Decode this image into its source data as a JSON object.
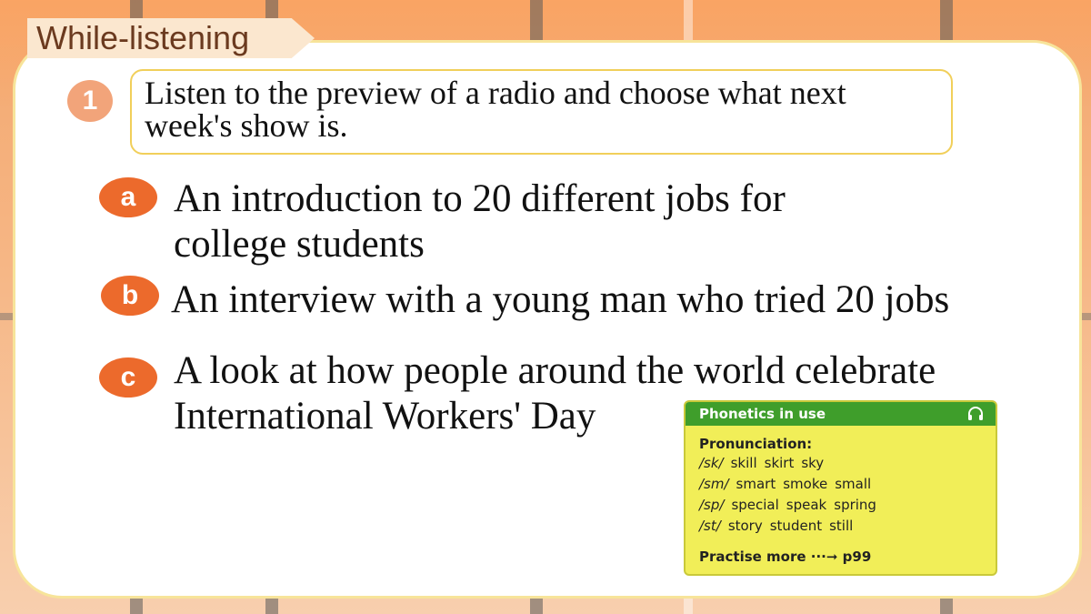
{
  "header": {
    "title": "While-listening"
  },
  "task": {
    "number": "1",
    "instruction_line1": "Listen to the preview of a radio and choose what next",
    "instruction_line2": "week's show is."
  },
  "options": [
    {
      "letter": "a",
      "line1": "An introduction to 20 different jobs for",
      "line2": "college students"
    },
    {
      "letter": "b",
      "line1": "An interview with a young man who tried 20 jobs"
    },
    {
      "letter": "c",
      "line1": "A look at how people around the world celebrate",
      "line2": "International Workers' Day"
    }
  ],
  "phonetics": {
    "title": "Phonetics in use",
    "icon": "headphones-icon",
    "subtitle": "Pronunciation:",
    "rows": [
      {
        "ipa": "/sk/",
        "words": [
          "skill",
          "skirt",
          "sky"
        ]
      },
      {
        "ipa": "/sm/",
        "words": [
          "smart",
          "smoke",
          "small"
        ]
      },
      {
        "ipa": "/sp/",
        "words": [
          "special",
          "speak",
          "spring"
        ]
      },
      {
        "ipa": "/st/",
        "words": [
          "story",
          "student",
          "still"
        ]
      }
    ],
    "more": "Practise more ···➞ p99"
  },
  "colors": {
    "title_tab": "#fbe7cf",
    "number_badge": "#f2a47a",
    "option_badge": "#ec6a2c",
    "card_border": "#f7e49a",
    "instruction_border": "#f1cf5a",
    "phonetics_bg": "#f1ee58",
    "phonetics_header": "#3f9e2b"
  }
}
